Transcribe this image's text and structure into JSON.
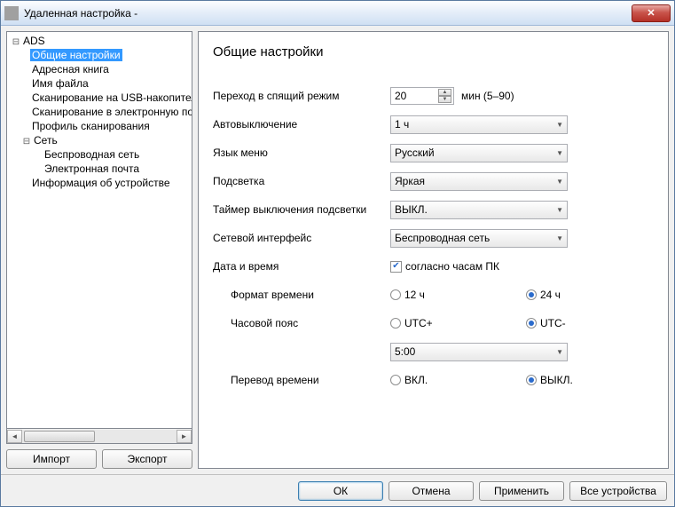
{
  "window": {
    "title": "Удаленная настройка -"
  },
  "tree": {
    "root": "ADS",
    "items": [
      "Общие настройки",
      "Адресная книга",
      "Имя файла",
      "Сканирование на USB-накопитель",
      "Сканирование в электронную почту",
      "Профиль сканирования"
    ],
    "net": "Сеть",
    "net_items": [
      "Беспроводная сеть",
      "Электронная почта"
    ],
    "info": "Информация об устройстве"
  },
  "sidebar_buttons": {
    "import": "Импорт",
    "export": "Экспорт"
  },
  "page": {
    "heading": "Общие настройки",
    "sleep_label": "Переход в спящий режим",
    "sleep_value": "20",
    "sleep_unit": "мин (5–90)",
    "autooff_label": "Автовыключение",
    "autooff_value": "1 ч",
    "lang_label": "Язык меню",
    "lang_value": "Русский",
    "backlight_label": "Подсветка",
    "backlight_value": "Яркая",
    "dimtimer_label": "Таймер выключения подсветки",
    "dimtimer_value": "ВЫКЛ.",
    "netif_label": "Сетевой интерфейс",
    "netif_value": "Беспроводная сеть",
    "datetime_label": "Дата и время",
    "pc_clock": "согласно часам ПК",
    "timefmt_label": "Формат времени",
    "timefmt_12": "12 ч",
    "timefmt_24": "24 ч",
    "tz_label": "Часовой пояс",
    "tz_utc_plus": "UTC+",
    "tz_utc_minus": "UTC-",
    "tz_value": "5:00",
    "dst_label": "Перевод времени",
    "dst_on": "ВКЛ.",
    "dst_off": "ВЫКЛ."
  },
  "footer": {
    "ok": "ОК",
    "cancel": "Отмена",
    "apply": "Применить",
    "all": "Все устройства"
  }
}
